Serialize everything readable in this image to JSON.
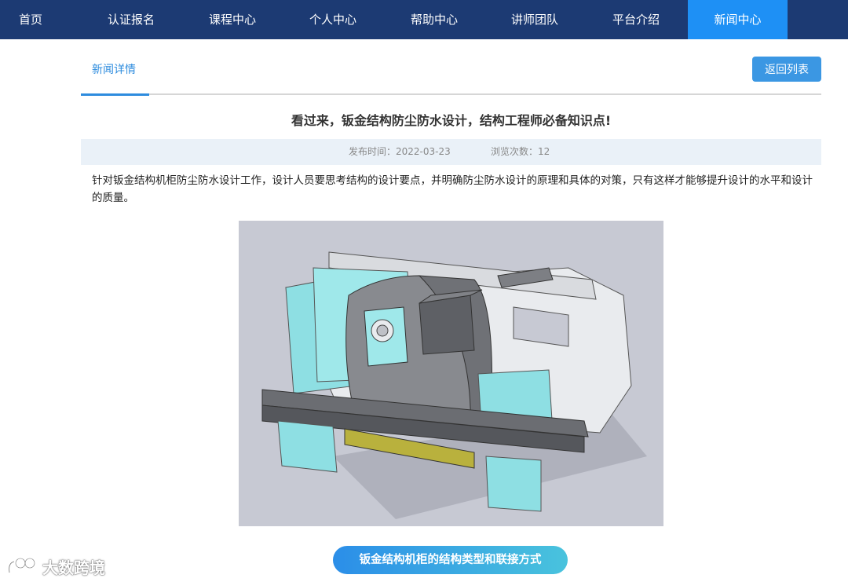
{
  "nav": {
    "items": [
      {
        "label": "首页",
        "active": false
      },
      {
        "label": "认证报名",
        "active": false
      },
      {
        "label": "课程中心",
        "active": false
      },
      {
        "label": "个人中心",
        "active": false
      },
      {
        "label": "帮助中心",
        "active": false
      },
      {
        "label": "讲师团队",
        "active": false
      },
      {
        "label": "平台介绍",
        "active": false
      },
      {
        "label": "新闻中心",
        "active": true
      }
    ]
  },
  "header": {
    "tab_label": "新闻详情",
    "back_label": "返回列表"
  },
  "article": {
    "title": "看过来，钣金结构防尘防水设计，结构工程师必备知识点!",
    "publish_time": "发布时间：2022-03-23",
    "view_count": "浏览次数：12",
    "paragraph": "针对钣金结构机柜防尘防水设计工作，设计人员要思考结构的设计要点，并明确防尘防水设计的原理和具体的对策，只有这样才能够提升设计的水平和设计的质量。",
    "section_pill": "钣金结构机柜的结构类型和联接方式"
  },
  "watermark": {
    "text": "大数跨境"
  },
  "colors": {
    "nav_bg": "#1c3a73",
    "nav_active": "#1e90f5",
    "accent": "#2e8cde"
  }
}
